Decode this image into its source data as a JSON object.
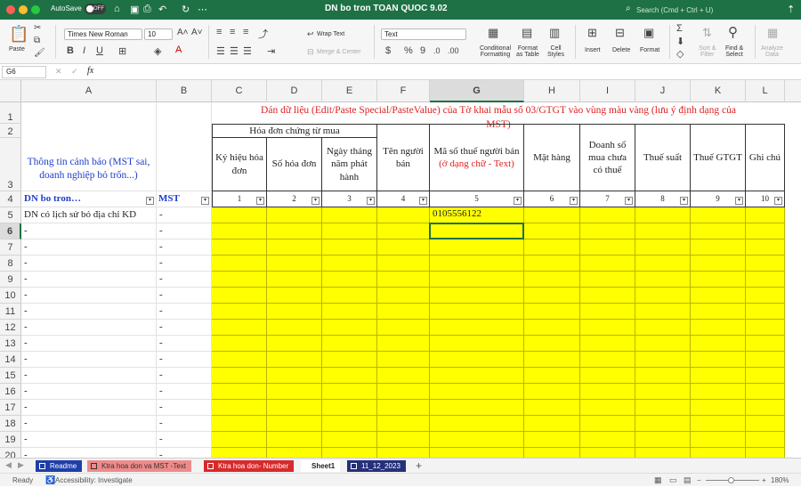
{
  "titlebar": {
    "autosave": "AutoSave",
    "toggle": "OFF",
    "title": "DN bo tron TOAN QUOC 9.02",
    "search": "Search (Cmd + Ctrl + U)"
  },
  "ribbon": {
    "paste": "Paste",
    "font": "Times New Roman",
    "size": "10",
    "wrap": "Wrap Text",
    "merge": "Merge & Center",
    "numfmt": "Text",
    "cond": "Conditional\nFormatting",
    "fmt_table": "Format\nas Table",
    "cell_styles": "Cell\nStyles",
    "insert": "Insert",
    "delete": "Delete",
    "format": "Format",
    "sort": "Sort &\nFilter",
    "find": "Find &\nSelect",
    "analyze": "Analyze\nData"
  },
  "formula": {
    "cell": "G6",
    "fx": "fx",
    "value": ""
  },
  "columns": [
    "A",
    "B",
    "C",
    "D",
    "E",
    "F",
    "G",
    "H",
    "I",
    "J",
    "K",
    "L"
  ],
  "rows": [
    "1",
    "2",
    "3",
    "4",
    "5",
    "6",
    "7",
    "8",
    "9",
    "10",
    "11",
    "12",
    "13",
    "14",
    "15",
    "16",
    "17",
    "18",
    "19",
    "20"
  ],
  "sheet": {
    "instruction": "Dán dữ liệu (Edit/Paste Special/PasteValue) của Tờ khai mẫu số  03/GTGT vào vùng màu vàng (lưu ý định dạng của MST)",
    "info_label": "Thông tin cảnh báo (MST sai, doanh nghiệp bỏ trốn...)",
    "group_header": "Hóa đơn chứng từ mua",
    "headers": {
      "c": "Ký hiệu hóa đơn",
      "d": "Số hóa đơn",
      "e": "Ngày tháng năm phát hành",
      "f": "Tên người bán",
      "g_black": "Mã số thuế người bán",
      "g_red": "(ở dạng chữ - Text)",
      "h": "Mặt hàng",
      "i": "Doanh số mua chưa có thuế",
      "j": "Thuế suất",
      "k": "Thuế GTGT",
      "l": "Ghi chú"
    },
    "row4_a": "DN bo tron…",
    "row4_b": "MST",
    "numbers": [
      "1",
      "2",
      "3",
      "4",
      "5",
      "6",
      "7",
      "8",
      "9",
      "10"
    ],
    "row5_a": "DN có lịch sử bỏ địa chỉ KD",
    "row5_b": "-",
    "row5_g": "0105556122",
    "dash": "-"
  },
  "tabs": [
    "Readme",
    "Ktra hoa don va MST -Text",
    "Ktra hoa don- Number",
    "Sheet1",
    "11_12_2023"
  ],
  "status": {
    "ready": "Ready",
    "accessibility": "Accessibility: Investigate",
    "zoom": "180%"
  }
}
